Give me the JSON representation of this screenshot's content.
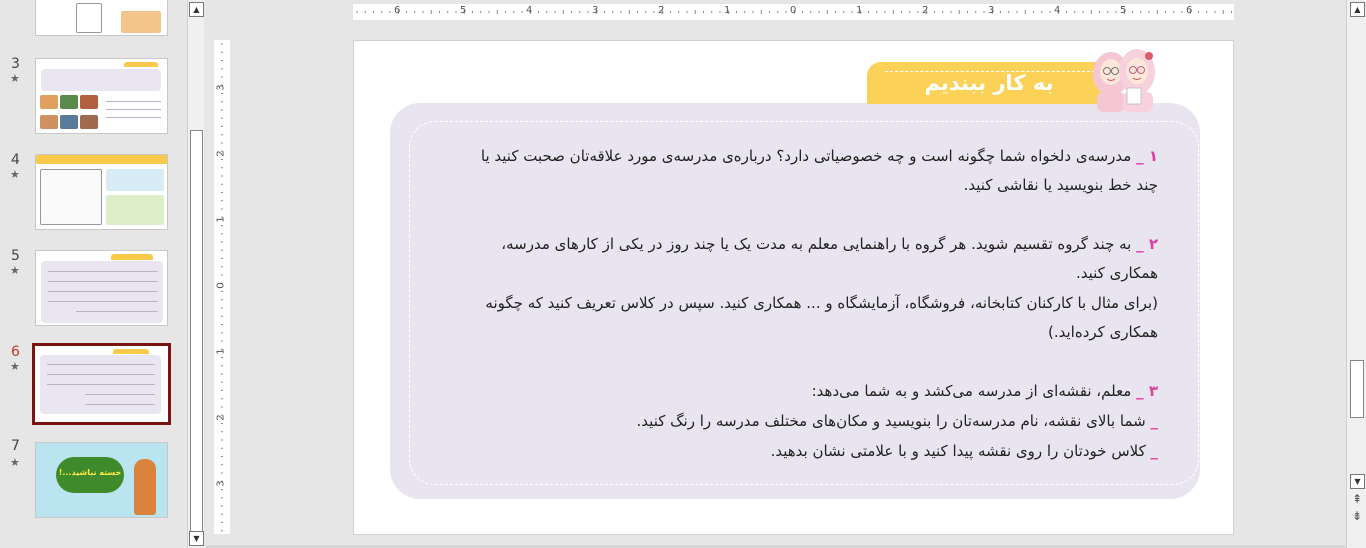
{
  "thumbnails": [
    {
      "number": "",
      "star": ""
    },
    {
      "number": "3",
      "star": "★"
    },
    {
      "number": "4",
      "star": "★"
    },
    {
      "number": "5",
      "star": "★"
    },
    {
      "number": "6",
      "star": "★"
    },
    {
      "number": "7",
      "star": "★"
    }
  ],
  "thumb7_text": "خسته نباشید...!",
  "ruler": {
    "horizontal": [
      "6",
      "5",
      "4",
      "3",
      "2",
      "1",
      "0",
      "1",
      "2",
      "3",
      "4",
      "5",
      "6"
    ],
    "vertical": [
      "3",
      "2",
      "1",
      "0",
      "1",
      "2",
      "3"
    ]
  },
  "slide": {
    "title": "به کار ببندیم",
    "items": [
      {
        "num": "۱ _",
        "text": " مدرسه‌ی دلخواه شما چگونه است و چه خصوصیاتی دارد؟ درباره‌ی مدرسه‌ی مورد علاقه‌تان صحبت کنید یا"
      },
      {
        "num": "",
        "text": "چند خط بنویسید یا نقاشی کنید."
      },
      {
        "num": "۲ _",
        "text": " به چند گروه تقسیم شوید. هر گروه با راهنمایی معلم به مدت یک یا چند روز در یکی از کارهای مدرسه،"
      },
      {
        "num": "",
        "text": "همکاری کنید."
      },
      {
        "num": "",
        "text": "(برای مثال با کارکنان کتابخانه، فروشگاه، آزمایشگاه و ... همکاری کنید. سپس در کلاس تعریف کنید که چگونه"
      },
      {
        "num": "",
        "text": "همکاری کرده‌اید.)"
      },
      {
        "num": "۳ _",
        "text": " معلم، نقشه‌ای از مدرسه می‌کشد و به شما می‌دهد:"
      },
      {
        "num": "_",
        "text": " شما بالای نقشه، نام مدرسه‌تان را بنویسید و مکان‌های مختلف مدرسه را رنگ کنید."
      },
      {
        "num": "_",
        "text": " کلاس خودتان را روی نقشه پیدا کنید و با علامتی نشان بدهید."
      }
    ]
  },
  "colors": {
    "accent_yellow": "#fbd257",
    "card_lavender": "#e9e5f0",
    "number_pink": "#e040a0",
    "active_thumb_border": "#7b1212",
    "active_number": "#c0392b"
  },
  "scroll": {
    "up": "▲",
    "down": "▼",
    "prev_slide": "⇞",
    "next_slide": "⇟"
  }
}
